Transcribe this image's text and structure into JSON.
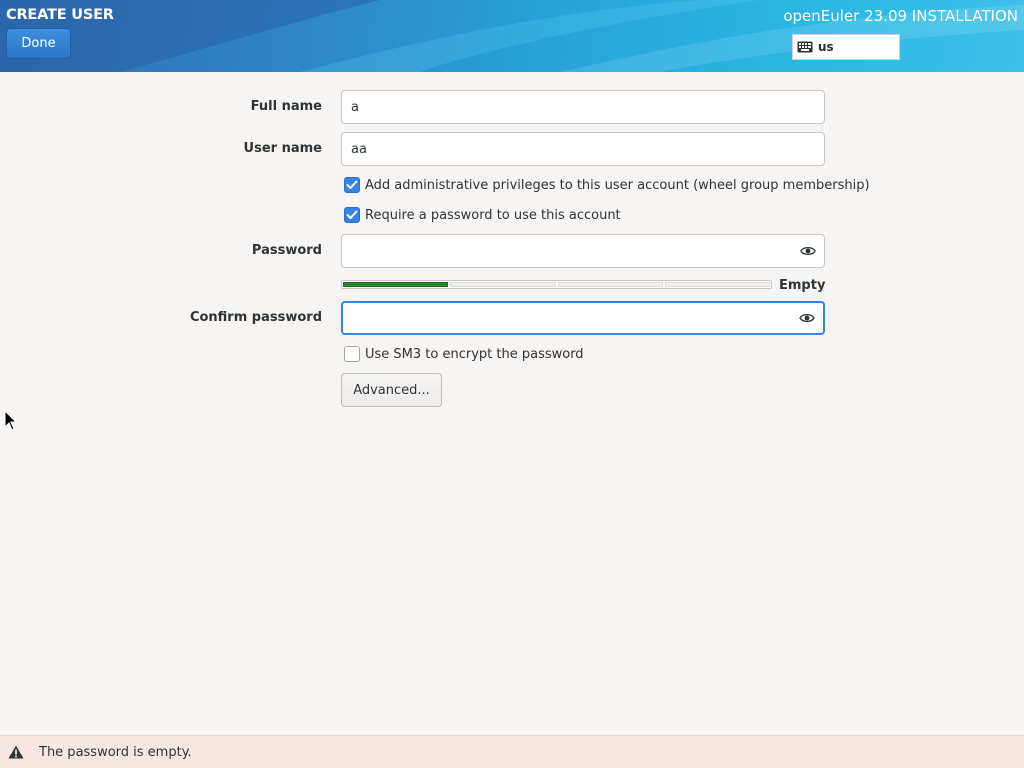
{
  "header": {
    "screen_title": "CREATE USER",
    "done_label": "Done",
    "product_title": "openEuler 23.09 INSTALLATION",
    "keyboard_layout": "us"
  },
  "form": {
    "full_name_label": "Full name",
    "full_name_value": "a",
    "user_name_label": "User name",
    "user_name_value": "aa",
    "admin_checkbox_label": "Add administrative privileges to this user account (wheel group membership)",
    "admin_checked": true,
    "require_password_label": "Require a password to use this account",
    "require_password_checked": true,
    "password_label": "Password",
    "password_value": "",
    "strength_label": "Empty",
    "strength_fraction": 0.25,
    "confirm_password_label": "Confirm password",
    "confirm_password_value": "",
    "sm3_label": "Use SM3 to encrypt the password",
    "sm3_checked": false,
    "advanced_label": "Advanced..."
  },
  "status": {
    "message": "The password is empty."
  },
  "colors": {
    "accent": "#3584e4",
    "strength_fill": "#26892d",
    "warning_bg": "#f6e7e2"
  },
  "icons": [
    "keyboard-icon",
    "eye-icon",
    "check-icon",
    "warning-icon",
    "mouse-pointer-icon"
  ]
}
